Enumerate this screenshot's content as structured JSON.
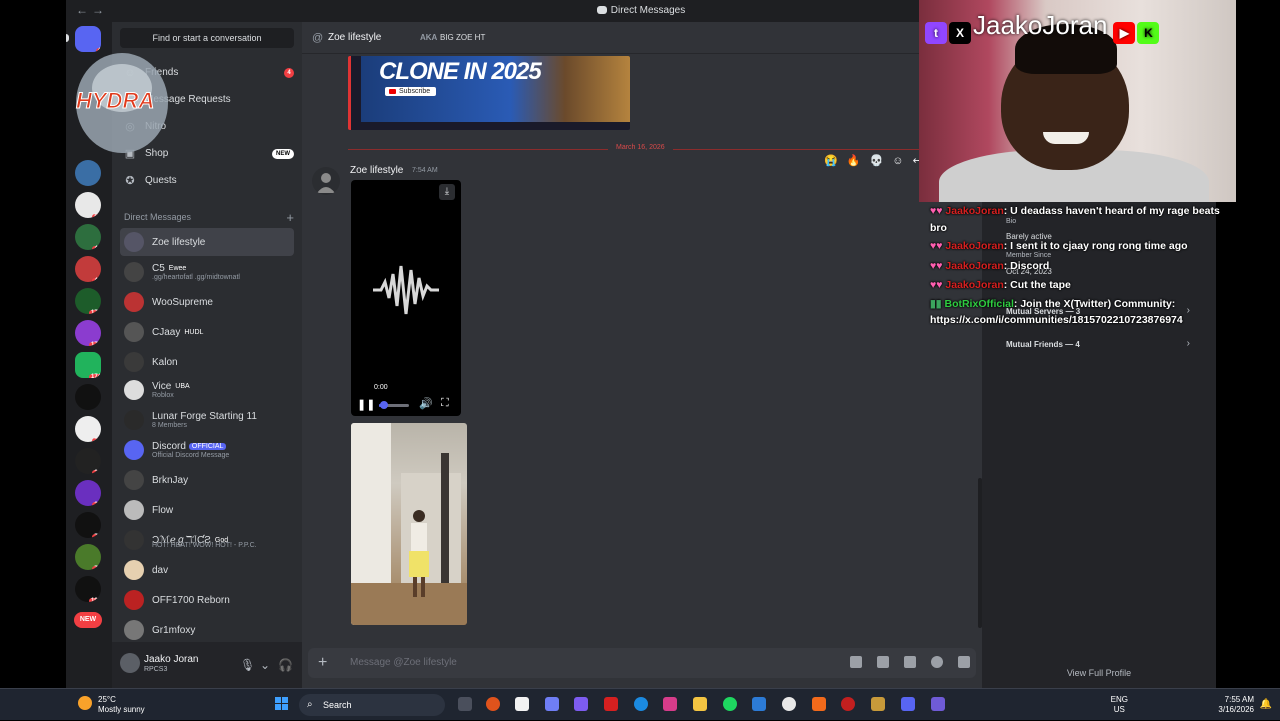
{
  "window": {
    "title": "Direct Messages"
  },
  "servers": {
    "badges": [
      "4",
      "62",
      "43",
      "47",
      "177",
      "174",
      "2",
      "30",
      "29",
      "31",
      "77",
      "78",
      "197"
    ],
    "new_label": "NEW"
  },
  "dm_column": {
    "search_label": "Find or start a conversation",
    "nav": [
      {
        "label": "Friends",
        "badge": "4"
      },
      {
        "label": "Message Requests"
      },
      {
        "label": "Nitro"
      },
      {
        "label": "Shop",
        "badge": "NEW"
      },
      {
        "label": "Quests"
      }
    ],
    "header": "Direct Messages",
    "dms": [
      {
        "name": "Zoe lifestyle",
        "status": "",
        "tag": ""
      },
      {
        "name": "C5",
        "tag": "Ewee",
        "status": ".gg/heartofatl .gg/midtownatl"
      },
      {
        "name": "WooSupreme",
        "status": "",
        "tag": ""
      },
      {
        "name": "CJaay",
        "tag": "HUDL",
        "status": ""
      },
      {
        "name": "Kalon",
        "status": "",
        "tag": ""
      },
      {
        "name": "Vice",
        "tag": "UBA",
        "status": "Roblox"
      },
      {
        "name": "Lunar Forge Starting 11",
        "status": "8 Members",
        "tag": ""
      },
      {
        "name": "Discord",
        "tag": "OFFICIAL",
        "status": "Official Discord Message"
      },
      {
        "name": "BrknJay",
        "status": "",
        "tag": ""
      },
      {
        "name": "Flow",
        "status": "",
        "tag": ""
      },
      {
        "name": "ƆℳℯℊℸℐƇƧ",
        "tag": "God",
        "status": "HOT! HEAT! WOW! HOT! - P.P.C."
      },
      {
        "name": "dav",
        "status": "",
        "tag": ""
      },
      {
        "name": "OFF1700 Reborn",
        "status": "",
        "tag": ""
      },
      {
        "name": "Gr1mfoxy",
        "status": "",
        "tag": ""
      }
    ],
    "user": {
      "name": "Jaako Joran",
      "status": "RPCS3"
    }
  },
  "chat": {
    "header_name": "Zoe lifestyle",
    "aka_label": "AKA",
    "aka_value": "BIG ZOE HT",
    "thumbnail_text": "CLONE IN 2025",
    "thumbnail_button": "Subscribe",
    "date_divider": "March 16, 2026",
    "message": {
      "author": "Zoe lifestyle",
      "time": "7:54 AM"
    },
    "reactions": [
      "😭",
      "🔥",
      "💀"
    ],
    "audio": {
      "time": "0:00",
      "progress": 0.05
    },
    "composer_placeholder": "Message @Zoe lifestyle"
  },
  "profile": {
    "bio_label": "Bio",
    "bio_value": "Barely active",
    "member_since_label": "Member Since",
    "member_since_value": "Oct 24, 2023",
    "mutual_servers": "Mutual Servers — 3",
    "mutual_friends": "Mutual Friends — 4",
    "view_full": "View Full Profile"
  },
  "stream": {
    "streamer": "JaakoJoran",
    "chat": [
      {
        "user": "JaakoJoran",
        "text": ": U deadass haven't heard of my rage beats"
      },
      {
        "user": "",
        "text": "bro"
      },
      {
        "user": "JaakoJoran",
        "text": ": I sent it to cjaay rong rong time ago"
      },
      {
        "user": "JaakoJoran",
        "text": ": Discord"
      },
      {
        "user": "JaakoJoran",
        "text": ": Cut the tape"
      },
      {
        "user": "BotRixOfficial",
        "text": ": Join the X(Twitter) Community:"
      },
      {
        "user": "",
        "text": "https://x.com/i/communities/1815702210723876974"
      }
    ]
  },
  "taskbar": {
    "temp": "25°C",
    "condition": "Mostly sunny",
    "search": "Search",
    "lang1": "ENG",
    "lang2": "US",
    "time": "7:55 AM",
    "date": "3/16/2026"
  },
  "colors": {
    "blurple": "#5865f2",
    "red": "#f23f43",
    "bg": "#313338"
  }
}
